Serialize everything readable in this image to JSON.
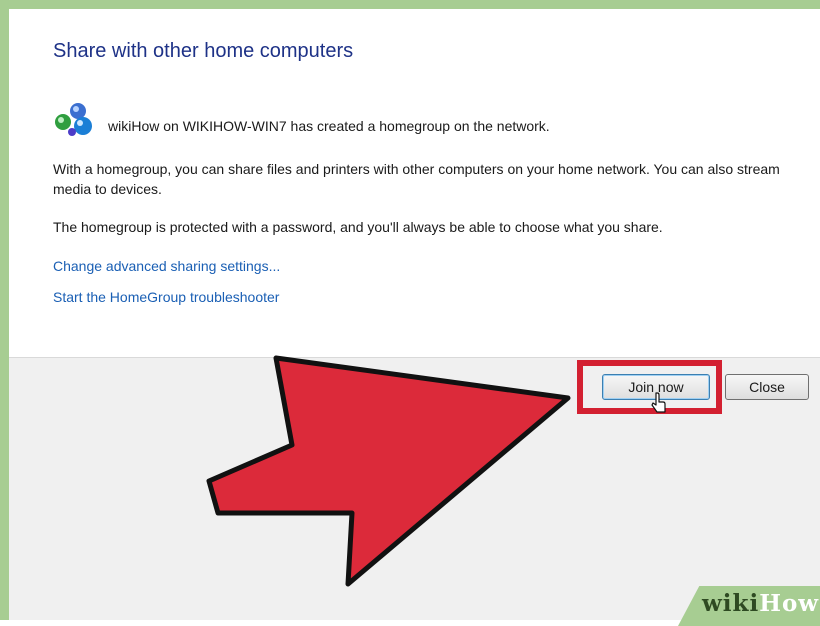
{
  "dialog": {
    "title": "Share with other home computers",
    "homegroup_message": "wikiHow on WIKIHOW-WIN7 has created a homegroup on the network.",
    "description_1": "With a homegroup, you can share files and printers with other computers on your home network. You can also stream media to devices.",
    "description_2": "The homegroup is protected with a password, and you'll always be able to choose what you share.",
    "links": [
      {
        "label": "Change advanced sharing settings..."
      },
      {
        "label": "Start the HomeGroup troubleshooter"
      }
    ],
    "buttons": {
      "join_label": "Join now",
      "close_label": "Close"
    },
    "icon": "homegroup-icon"
  },
  "annotation": {
    "arrow_color": "#dc2a3a",
    "highlight_color": "#d32031",
    "target": "join-now-button"
  },
  "watermark": {
    "part1": "wiki",
    "part2": "How",
    "color": "#a7cd92"
  },
  "colors": {
    "frame": "#a7cd92",
    "title": "#1e3287",
    "link": "#1a5fb4",
    "footer": "#f0f0f0"
  }
}
